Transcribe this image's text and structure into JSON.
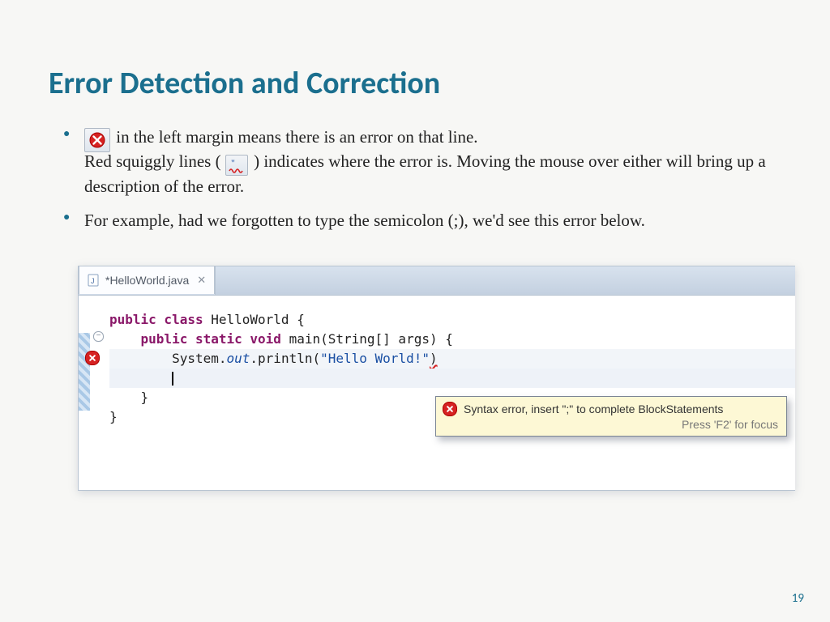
{
  "title": "Error Detection and Correction",
  "bullets": {
    "b1_a": " in the left margin means there is an error on that line.",
    "b1_b": "Red squiggly lines ( ",
    "b1_c": " ) indicates where the error is. Moving the mouse over either will bring up a description of the error.",
    "b2": "For example, had we forgotten to type the semicolon (;), we'd see this error below."
  },
  "editor": {
    "tab_label": "*HelloWorld.java",
    "code": {
      "l1_a": "public",
      "l1_b": " class",
      "l1_c": " HelloWorld {",
      "l2_a": "public",
      "l2_b": " static",
      "l2_c": " void",
      "l2_d": " main(String[] args) {",
      "l3_a": "System.",
      "l3_b": "out",
      "l3_c": ".println(",
      "l3_d": "\"Hello World!\"",
      "l3_e": ")",
      "l5": "}",
      "l6": "}"
    }
  },
  "tooltip": {
    "msg": "Syntax error, insert \";\" to complete BlockStatements",
    "hint": "Press 'F2' for focus"
  },
  "page_number": "19"
}
